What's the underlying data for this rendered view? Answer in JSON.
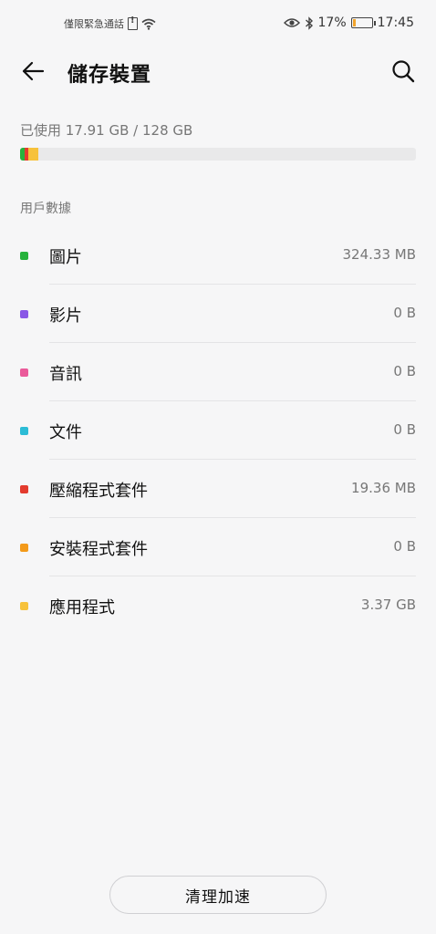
{
  "status_bar": {
    "carrier_text": "僅限緊急通話",
    "battery_percent": "17%",
    "battery_level": 0.17,
    "time": "17:45"
  },
  "app_bar": {
    "title": "儲存裝置"
  },
  "usage": {
    "text": "已使用 17.91 GB / 128 GB",
    "segments": [
      {
        "color": "#27b23c",
        "fraction": 0.012
      },
      {
        "color": "#e33b2e",
        "fraction": 0.008
      },
      {
        "color": "#f7c23b",
        "fraction": 0.026
      }
    ]
  },
  "section": {
    "title": "用戶數據"
  },
  "items": [
    {
      "label": "圖片",
      "size": "324.33 MB",
      "color": "#27b23c"
    },
    {
      "label": "影片",
      "size": "0 B",
      "color": "#8a58e6"
    },
    {
      "label": "音訊",
      "size": "0 B",
      "color": "#ea5a9a"
    },
    {
      "label": "文件",
      "size": "0 B",
      "color": "#2cbcd6"
    },
    {
      "label": "壓縮程式套件",
      "size": "19.36 MB",
      "color": "#e33b2e"
    },
    {
      "label": "安裝程式套件",
      "size": "0 B",
      "color": "#f39a1a"
    },
    {
      "label": "應用程式",
      "size": "3.37 GB",
      "color": "#f7c23b"
    }
  ],
  "footer": {
    "clean_label": "清理加速"
  },
  "icons": {
    "back": "arrow-left-icon",
    "search": "search-icon",
    "sim": "sim-alert-icon",
    "wifi": "wifi-icon",
    "eye": "eye-comfort-icon",
    "bluetooth": "bluetooth-icon",
    "battery": "battery-icon"
  }
}
